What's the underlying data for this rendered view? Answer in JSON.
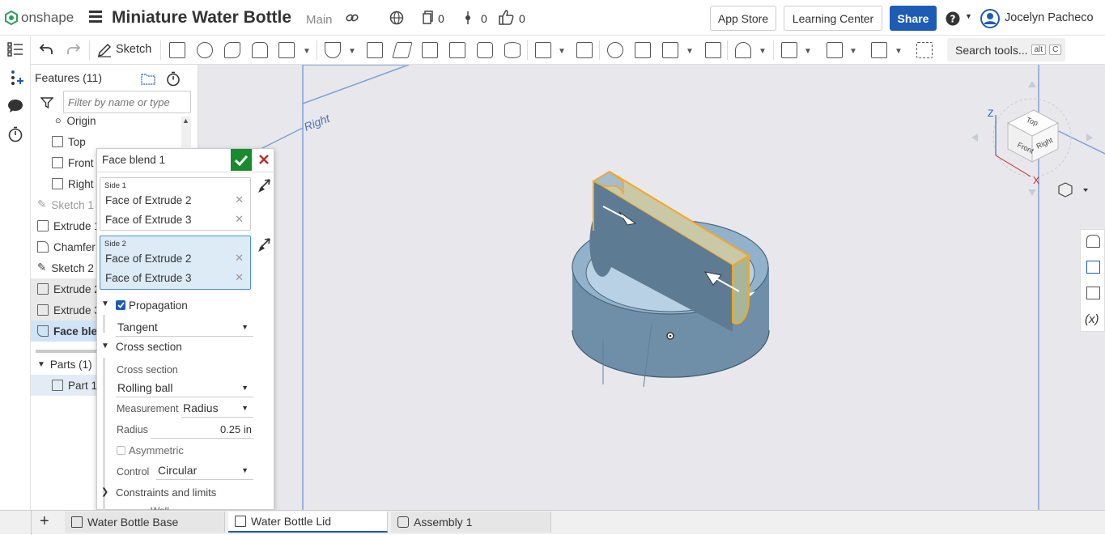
{
  "app": {
    "brand": "onshape",
    "doc_title": "Miniature Water Bottle",
    "branch": "Main"
  },
  "header": {
    "versions_count": "0",
    "branches_count": "0",
    "likes_count": "0",
    "app_store_label": "App Store",
    "learning_center_label": "Learning Center",
    "share_label": "Share",
    "user_name": "Jocelyn Pacheco"
  },
  "toolbar": {
    "sketch_label": "Sketch",
    "search_label": "Search tools...",
    "search_shortcut_1": "alt",
    "search_shortcut_2": "C"
  },
  "features": {
    "header": "Features (11)",
    "filter_placeholder": "Filter by name or type",
    "items": [
      {
        "label": "Origin"
      },
      {
        "label": "Top"
      },
      {
        "label": "Front"
      },
      {
        "label": "Right"
      },
      {
        "label": "Sketch 1"
      },
      {
        "label": "Extrude 1"
      },
      {
        "label": "Chamfer"
      },
      {
        "label": "Sketch 2"
      },
      {
        "label": "Extrude 2"
      },
      {
        "label": "Extrude 3"
      },
      {
        "label": "Face blend"
      }
    ],
    "parts_header": "Parts (1)",
    "parts": [
      {
        "label": "Part 1"
      }
    ]
  },
  "dialog": {
    "title": "Face blend 1",
    "side1_label": "Side 1",
    "side1_items": [
      "Face of Extrude 2",
      "Face of Extrude 3"
    ],
    "side2_label": "Side 2",
    "side2_items": [
      "Face of Extrude 2",
      "Face of Extrude 3"
    ],
    "propagation_label": "Propagation",
    "propagation_checked": true,
    "propagation_value": "Tangent",
    "cross_section_header": "Cross section",
    "cross_section_label": "Cross section",
    "cross_section_value": "Rolling ball",
    "measurement_label": "Measurement",
    "measurement_value": "Radius",
    "radius_label": "Radius",
    "radius_value": "0.25 in",
    "asymmetric_label": "Asymmetric",
    "control_label": "Control",
    "control_value": "Circular",
    "constraints_label": "Constraints and limits",
    "partial_label": "Wall"
  },
  "viewport": {
    "plane_label": "Right"
  },
  "viewcube": {
    "top": "Top",
    "front": "Front",
    "right": "Right",
    "x": "X",
    "z": "Z"
  },
  "tabs": [
    {
      "label": "Water Bottle Base",
      "active": false
    },
    {
      "label": "Water Bottle Lid",
      "active": true
    },
    {
      "label": "Assembly 1",
      "active": false
    }
  ],
  "colors": {
    "accent": "#1e5bb5",
    "confirm": "#1a8a2e",
    "cancel": "#c0282d",
    "selection": "#f5a623",
    "part": "#7fa3bd"
  }
}
